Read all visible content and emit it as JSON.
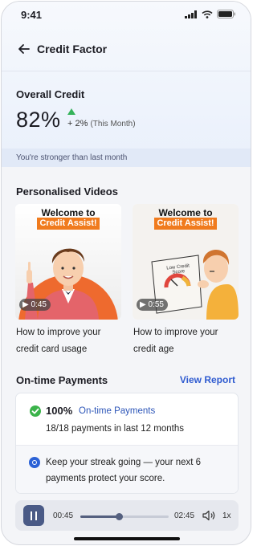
{
  "status_bar": {
    "time": "9:41"
  },
  "header": {
    "title": "Credit Factor"
  },
  "overall": {
    "label": "Overall Credit",
    "percent": "82%",
    "change": "+ 2%",
    "change_period": "(This Month)",
    "banner": "You're stronger than last month"
  },
  "videos": {
    "title": "Personalised Videos",
    "items": [
      {
        "heading": "Welcome to",
        "tag": "Credit Assist!",
        "duration": "0:45",
        "caption_line1": "How to improve your",
        "caption_line2": "credit card usage"
      },
      {
        "heading": "Welcome to",
        "tag": "Credit Assist!",
        "duration": "0:55",
        "caption_line1": "How to improve your",
        "caption_line2": "credit age",
        "sign_line1": "Low Credit",
        "sign_line2": "Score"
      }
    ]
  },
  "payments": {
    "title": "On-time Payments",
    "link": "View Report",
    "percent": "100%",
    "label": "On-time Payments",
    "detail": "18/18 payments in last 12 months",
    "tip": "Keep your streak going — your next 6 payments protect your score."
  },
  "player": {
    "current": "00:45",
    "total": "02:45",
    "progress": 0.44,
    "speed": "1x"
  },
  "colors": {
    "accent_blue": "#2f5bd0",
    "positive_green": "#35b35a",
    "tag_orange": "#f07b1e"
  }
}
